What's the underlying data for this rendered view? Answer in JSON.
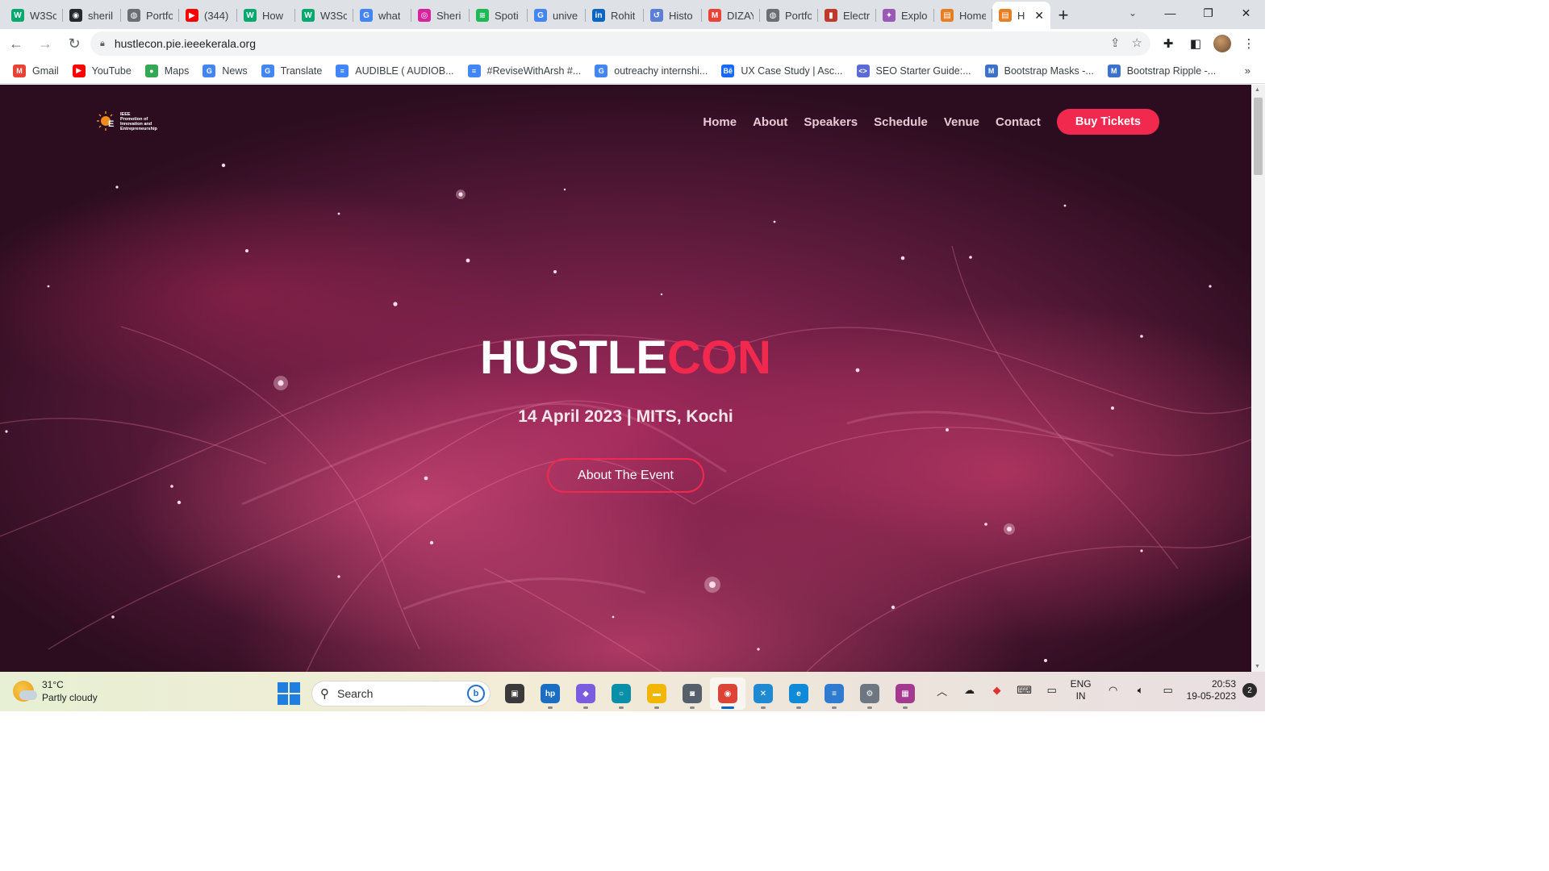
{
  "browser": {
    "tabs": [
      {
        "title": "W3Sc",
        "icon": "w3schools-icon",
        "color": "#04aa6d",
        "glyph": "W"
      },
      {
        "title": "sheril",
        "icon": "github-icon",
        "color": "#24292f",
        "glyph": "◉"
      },
      {
        "title": "Portfo",
        "icon": "globe-icon",
        "color": "#6b6f75",
        "glyph": "◍"
      },
      {
        "title": "(344)",
        "icon": "youtube-icon",
        "color": "#ff0000",
        "glyph": "▶"
      },
      {
        "title": "How",
        "icon": "w3schools-icon",
        "color": "#04aa6d",
        "glyph": "W"
      },
      {
        "title": "W3Sc",
        "icon": "w3schools-icon",
        "color": "#04aa6d",
        "glyph": "W"
      },
      {
        "title": "what",
        "icon": "google-icon",
        "color": "#4285f4",
        "glyph": "G"
      },
      {
        "title": "Sheri",
        "icon": "instagram-icon",
        "color": "#d6249f",
        "glyph": "◎"
      },
      {
        "title": "Spoti",
        "icon": "spotify-icon",
        "color": "#1db954",
        "glyph": "≋"
      },
      {
        "title": "unive",
        "icon": "google-icon",
        "color": "#4285f4",
        "glyph": "G"
      },
      {
        "title": "Rohit",
        "icon": "linkedin-icon",
        "color": "#0a66c2",
        "glyph": "in"
      },
      {
        "title": "Histo",
        "icon": "history-icon",
        "color": "#5b7fd6",
        "glyph": "↺"
      },
      {
        "title": "DIZAY",
        "icon": "gmail-icon",
        "color": "#ea4335",
        "glyph": "M"
      },
      {
        "title": "Portfo",
        "icon": "globe-icon",
        "color": "#6b6f75",
        "glyph": "◍"
      },
      {
        "title": "Electr",
        "icon": "book-icon",
        "color": "#c0392b",
        "glyph": "▮"
      },
      {
        "title": "Explo",
        "icon": "explore-icon",
        "color": "#9b59b6",
        "glyph": "✦"
      },
      {
        "title": "Home",
        "icon": "page-icon",
        "color": "#e67e22",
        "glyph": "▤"
      },
      {
        "title": "H",
        "icon": "page-icon",
        "color": "#e67e22",
        "glyph": "▤",
        "active": true
      }
    ],
    "url": "hustlecon.pie.ieeekerala.org",
    "bookmarks": [
      {
        "label": "Gmail",
        "icon": "gmail-icon",
        "color": "#ea4335",
        "glyph": "M"
      },
      {
        "label": "YouTube",
        "icon": "youtube-icon",
        "color": "#ff0000",
        "glyph": "▶"
      },
      {
        "label": "Maps",
        "icon": "maps-icon",
        "color": "#34a853",
        "glyph": "●"
      },
      {
        "label": "News",
        "icon": "news-icon",
        "color": "#4285f4",
        "glyph": "G"
      },
      {
        "label": "Translate",
        "icon": "translate-icon",
        "color": "#4285f4",
        "glyph": "G"
      },
      {
        "label": "AUDIBLE ( AUDIOB...",
        "icon": "docs-icon",
        "color": "#4285f4",
        "glyph": "≡"
      },
      {
        "label": "#ReviseWithArsh #...",
        "icon": "docs-icon",
        "color": "#4285f4",
        "glyph": "≡"
      },
      {
        "label": "outreachy internshi...",
        "icon": "google-icon",
        "color": "#4285f4",
        "glyph": "G"
      },
      {
        "label": "UX Case Study | Asc...",
        "icon": "behance-icon",
        "color": "#1769ff",
        "glyph": "Bē"
      },
      {
        "label": "SEO Starter Guide:...",
        "icon": "code-icon",
        "color": "#5b6bd6",
        "glyph": "<>"
      },
      {
        "label": "Bootstrap Masks -...",
        "icon": "mdb-icon",
        "color": "#3b71ca",
        "glyph": "M"
      },
      {
        "label": "Bootstrap Ripple -...",
        "icon": "mdb-icon",
        "color": "#3b71ca",
        "glyph": "M"
      }
    ]
  },
  "site": {
    "logo_lines": [
      "IEEE",
      "Promotion of",
      "Innovation and",
      "Entrepreneurship"
    ],
    "nav": [
      "Home",
      "About",
      "Speakers",
      "Schedule",
      "Venue",
      "Contact"
    ],
    "buy_label": "Buy Tickets",
    "title_main": "HUSTLE",
    "title_accent": "CON",
    "subtitle": "14 April 2023 | MITS, Kochi",
    "cta_label": "About The Event",
    "accent_color": "#f2294e"
  },
  "taskbar": {
    "temperature": "31°C",
    "weather": "Partly cloudy",
    "search_placeholder": "Search",
    "apps": [
      {
        "name": "task-view",
        "color": "#3a3a3a",
        "glyph": "▣"
      },
      {
        "name": "myhp",
        "color": "#1b6ec2",
        "glyph": "hp"
      },
      {
        "name": "copilot",
        "color": "#7a5ce0",
        "glyph": "◆"
      },
      {
        "name": "cortana",
        "color": "#0a8fa8",
        "glyph": "○"
      },
      {
        "name": "file-explorer",
        "color": "#f2b705",
        "glyph": "▬"
      },
      {
        "name": "camera",
        "color": "#55606b",
        "glyph": "◙"
      },
      {
        "name": "chrome",
        "color": "#db4437",
        "glyph": "◉",
        "active": true
      },
      {
        "name": "vscode",
        "color": "#1f8ad2",
        "glyph": "✕"
      },
      {
        "name": "edge",
        "color": "#0f8ad8",
        "glyph": "e"
      },
      {
        "name": "notepad",
        "color": "#2f7bd0",
        "glyph": "≡"
      },
      {
        "name": "settings",
        "color": "#6e7781",
        "glyph": "⚙"
      },
      {
        "name": "winrar",
        "color": "#a33a8f",
        "glyph": "▦"
      }
    ],
    "lang_top": "ENG",
    "lang_bottom": "IN",
    "time": "20:53",
    "date": "19-05-2023",
    "notifications": "2"
  }
}
